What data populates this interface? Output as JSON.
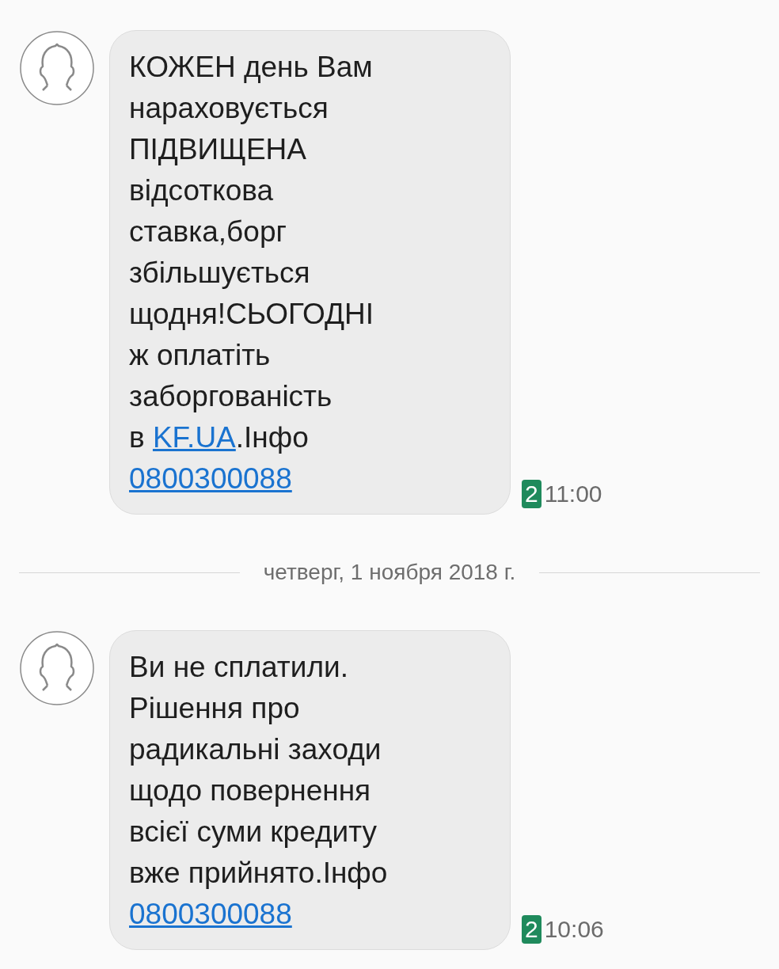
{
  "messages": [
    {
      "lines": [
        [
          {
            "kind": "text",
            "text": "КОЖЕН день Вам"
          }
        ],
        [
          {
            "kind": "text",
            "text": "нараховується"
          }
        ],
        [
          {
            "kind": "text",
            "text": "ПІДВИЩЕНА"
          }
        ],
        [
          {
            "kind": "text",
            "text": "відсоткова"
          }
        ],
        [
          {
            "kind": "text",
            "text": "ставка,борг"
          }
        ],
        [
          {
            "kind": "text",
            "text": "збільшується"
          }
        ],
        [
          {
            "kind": "text",
            "text": "щодня!СЬОГОДНІ"
          }
        ],
        [
          {
            "kind": "text",
            "text": "ж оплатіть"
          }
        ],
        [
          {
            "kind": "text",
            "text": "заборгованість"
          }
        ],
        [
          {
            "kind": "text",
            "text": "в "
          },
          {
            "kind": "link",
            "text": "KF.UA"
          },
          {
            "kind": "text",
            "text": ".Інфо"
          }
        ],
        [
          {
            "kind": "link",
            "text": "0800300088"
          }
        ]
      ],
      "sim": "2",
      "time": "11:00"
    },
    {
      "kind": "divider",
      "text": "четверг, 1 ноября 2018 г."
    },
    {
      "lines": [
        [
          {
            "kind": "text",
            "text": "Ви не сплатили."
          }
        ],
        [
          {
            "kind": "text",
            "text": "Рішення про"
          }
        ],
        [
          {
            "kind": "text",
            "text": "радикальні заходи"
          }
        ],
        [
          {
            "kind": "text",
            "text": "щодо повернення"
          }
        ],
        [
          {
            "kind": "text",
            "text": "всієї суми кредиту"
          }
        ],
        [
          {
            "kind": "text",
            "text": "вже прийнято.Інфо"
          }
        ],
        [
          {
            "kind": "link",
            "text": "0800300088"
          }
        ]
      ],
      "sim": "2",
      "time": "10:06"
    }
  ]
}
